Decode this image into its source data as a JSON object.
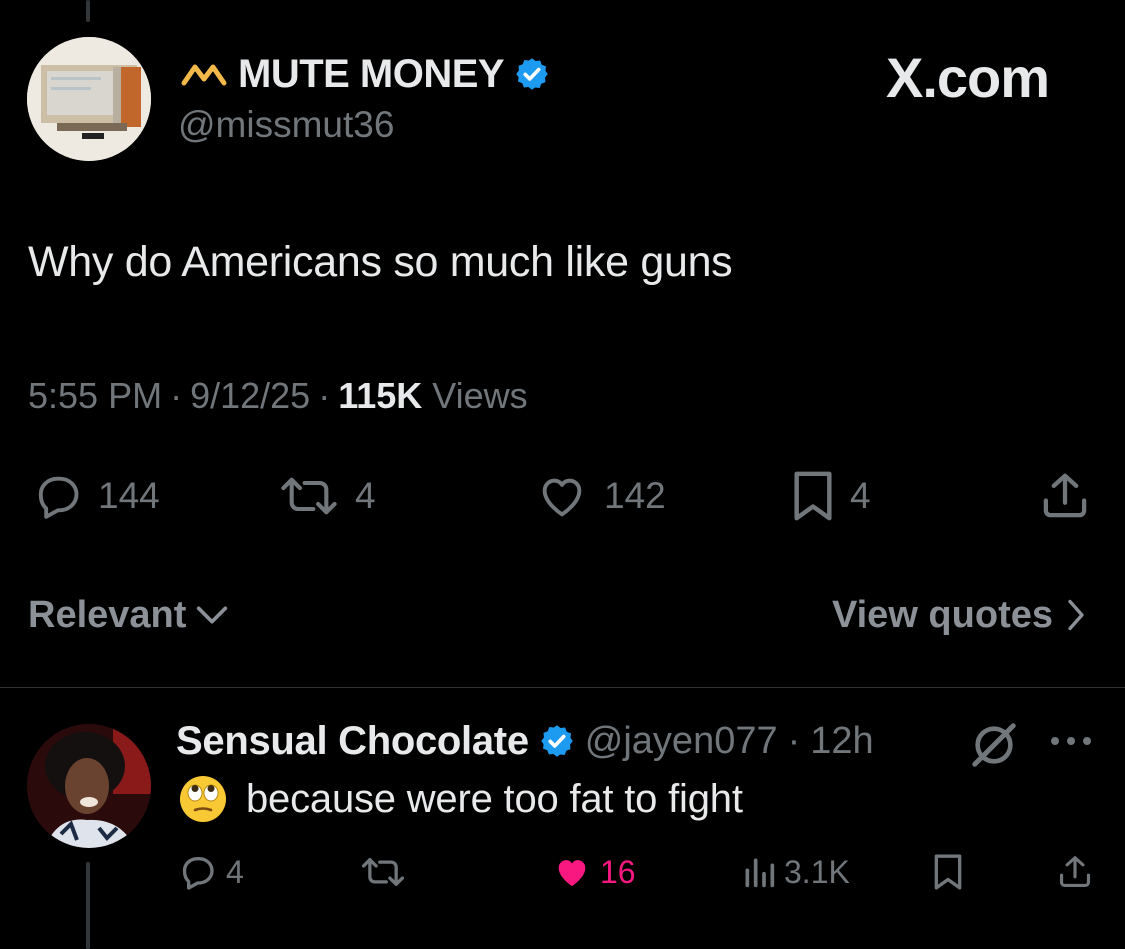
{
  "tweet": {
    "author_name": "MUTE MONEY",
    "author_handle": "@missmut36",
    "brand_label": "X.com",
    "text": "Why do Americans so much like guns",
    "time": "5:55 PM",
    "date": "9/12/25",
    "views_count": "115K",
    "views_label": "Views",
    "replies": "144",
    "reposts": "4",
    "likes": "142",
    "bookmarks": "4",
    "icons": [
      "brand-m-icon",
      "verified-badge-icon",
      "reply-icon",
      "repost-icon",
      "like-icon",
      "bookmark-icon",
      "share-icon"
    ]
  },
  "sort": {
    "label": "Relevant",
    "view_quotes_label": "View quotes"
  },
  "reply": {
    "author_name": "Sensual Chocolate",
    "author_handle": "@jayen077",
    "time": "12h",
    "emoji_name": "face-with-rolling-eyes",
    "text": "because were too fat to fight",
    "replies": "4",
    "likes": "16",
    "views": "3.1K",
    "icons": [
      "verified-badge-icon",
      "grok-icon",
      "more-icon",
      "reply-icon",
      "repost-icon",
      "like-filled-icon",
      "views-icon",
      "bookmark-icon",
      "share-icon"
    ]
  },
  "colors": {
    "background": "#000000",
    "primary_text": "#e7e9ea",
    "secondary_text": "#71767b",
    "verified_blue": "#1d9bf0",
    "like_pink": "#f91880",
    "brand_gold": "#f2b94a"
  }
}
